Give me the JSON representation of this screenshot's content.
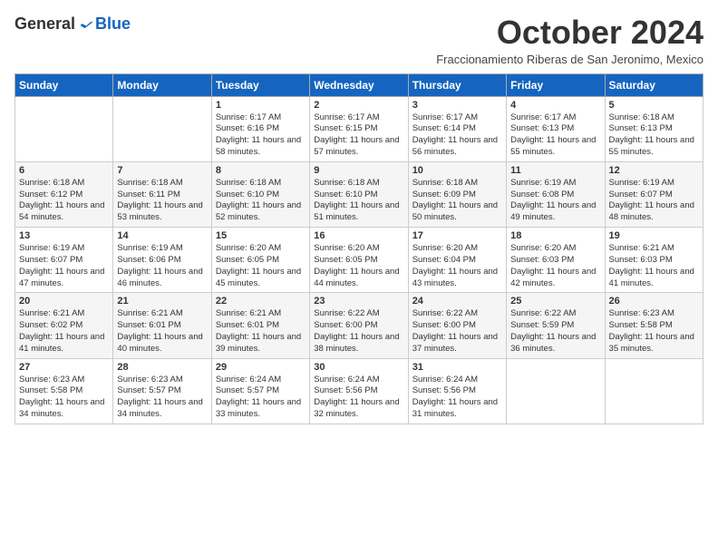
{
  "header": {
    "logo_general": "General",
    "logo_blue": "Blue",
    "month_title": "October 2024",
    "subtitle": "Fraccionamiento Riberas de San Jeronimo, Mexico"
  },
  "days_of_week": [
    "Sunday",
    "Monday",
    "Tuesday",
    "Wednesday",
    "Thursday",
    "Friday",
    "Saturday"
  ],
  "weeks": [
    [
      {
        "day": "",
        "info": ""
      },
      {
        "day": "",
        "info": ""
      },
      {
        "day": "1",
        "info": "Sunrise: 6:17 AM\nSunset: 6:16 PM\nDaylight: 11 hours and 58 minutes."
      },
      {
        "day": "2",
        "info": "Sunrise: 6:17 AM\nSunset: 6:15 PM\nDaylight: 11 hours and 57 minutes."
      },
      {
        "day": "3",
        "info": "Sunrise: 6:17 AM\nSunset: 6:14 PM\nDaylight: 11 hours and 56 minutes."
      },
      {
        "day": "4",
        "info": "Sunrise: 6:17 AM\nSunset: 6:13 PM\nDaylight: 11 hours and 55 minutes."
      },
      {
        "day": "5",
        "info": "Sunrise: 6:18 AM\nSunset: 6:13 PM\nDaylight: 11 hours and 55 minutes."
      }
    ],
    [
      {
        "day": "6",
        "info": "Sunrise: 6:18 AM\nSunset: 6:12 PM\nDaylight: 11 hours and 54 minutes."
      },
      {
        "day": "7",
        "info": "Sunrise: 6:18 AM\nSunset: 6:11 PM\nDaylight: 11 hours and 53 minutes."
      },
      {
        "day": "8",
        "info": "Sunrise: 6:18 AM\nSunset: 6:10 PM\nDaylight: 11 hours and 52 minutes."
      },
      {
        "day": "9",
        "info": "Sunrise: 6:18 AM\nSunset: 6:10 PM\nDaylight: 11 hours and 51 minutes."
      },
      {
        "day": "10",
        "info": "Sunrise: 6:18 AM\nSunset: 6:09 PM\nDaylight: 11 hours and 50 minutes."
      },
      {
        "day": "11",
        "info": "Sunrise: 6:19 AM\nSunset: 6:08 PM\nDaylight: 11 hours and 49 minutes."
      },
      {
        "day": "12",
        "info": "Sunrise: 6:19 AM\nSunset: 6:07 PM\nDaylight: 11 hours and 48 minutes."
      }
    ],
    [
      {
        "day": "13",
        "info": "Sunrise: 6:19 AM\nSunset: 6:07 PM\nDaylight: 11 hours and 47 minutes."
      },
      {
        "day": "14",
        "info": "Sunrise: 6:19 AM\nSunset: 6:06 PM\nDaylight: 11 hours and 46 minutes."
      },
      {
        "day": "15",
        "info": "Sunrise: 6:20 AM\nSunset: 6:05 PM\nDaylight: 11 hours and 45 minutes."
      },
      {
        "day": "16",
        "info": "Sunrise: 6:20 AM\nSunset: 6:05 PM\nDaylight: 11 hours and 44 minutes."
      },
      {
        "day": "17",
        "info": "Sunrise: 6:20 AM\nSunset: 6:04 PM\nDaylight: 11 hours and 43 minutes."
      },
      {
        "day": "18",
        "info": "Sunrise: 6:20 AM\nSunset: 6:03 PM\nDaylight: 11 hours and 42 minutes."
      },
      {
        "day": "19",
        "info": "Sunrise: 6:21 AM\nSunset: 6:03 PM\nDaylight: 11 hours and 41 minutes."
      }
    ],
    [
      {
        "day": "20",
        "info": "Sunrise: 6:21 AM\nSunset: 6:02 PM\nDaylight: 11 hours and 41 minutes."
      },
      {
        "day": "21",
        "info": "Sunrise: 6:21 AM\nSunset: 6:01 PM\nDaylight: 11 hours and 40 minutes."
      },
      {
        "day": "22",
        "info": "Sunrise: 6:21 AM\nSunset: 6:01 PM\nDaylight: 11 hours and 39 minutes."
      },
      {
        "day": "23",
        "info": "Sunrise: 6:22 AM\nSunset: 6:00 PM\nDaylight: 11 hours and 38 minutes."
      },
      {
        "day": "24",
        "info": "Sunrise: 6:22 AM\nSunset: 6:00 PM\nDaylight: 11 hours and 37 minutes."
      },
      {
        "day": "25",
        "info": "Sunrise: 6:22 AM\nSunset: 5:59 PM\nDaylight: 11 hours and 36 minutes."
      },
      {
        "day": "26",
        "info": "Sunrise: 6:23 AM\nSunset: 5:58 PM\nDaylight: 11 hours and 35 minutes."
      }
    ],
    [
      {
        "day": "27",
        "info": "Sunrise: 6:23 AM\nSunset: 5:58 PM\nDaylight: 11 hours and 34 minutes."
      },
      {
        "day": "28",
        "info": "Sunrise: 6:23 AM\nSunset: 5:57 PM\nDaylight: 11 hours and 34 minutes."
      },
      {
        "day": "29",
        "info": "Sunrise: 6:24 AM\nSunset: 5:57 PM\nDaylight: 11 hours and 33 minutes."
      },
      {
        "day": "30",
        "info": "Sunrise: 6:24 AM\nSunset: 5:56 PM\nDaylight: 11 hours and 32 minutes."
      },
      {
        "day": "31",
        "info": "Sunrise: 6:24 AM\nSunset: 5:56 PM\nDaylight: 11 hours and 31 minutes."
      },
      {
        "day": "",
        "info": ""
      },
      {
        "day": "",
        "info": ""
      }
    ]
  ]
}
